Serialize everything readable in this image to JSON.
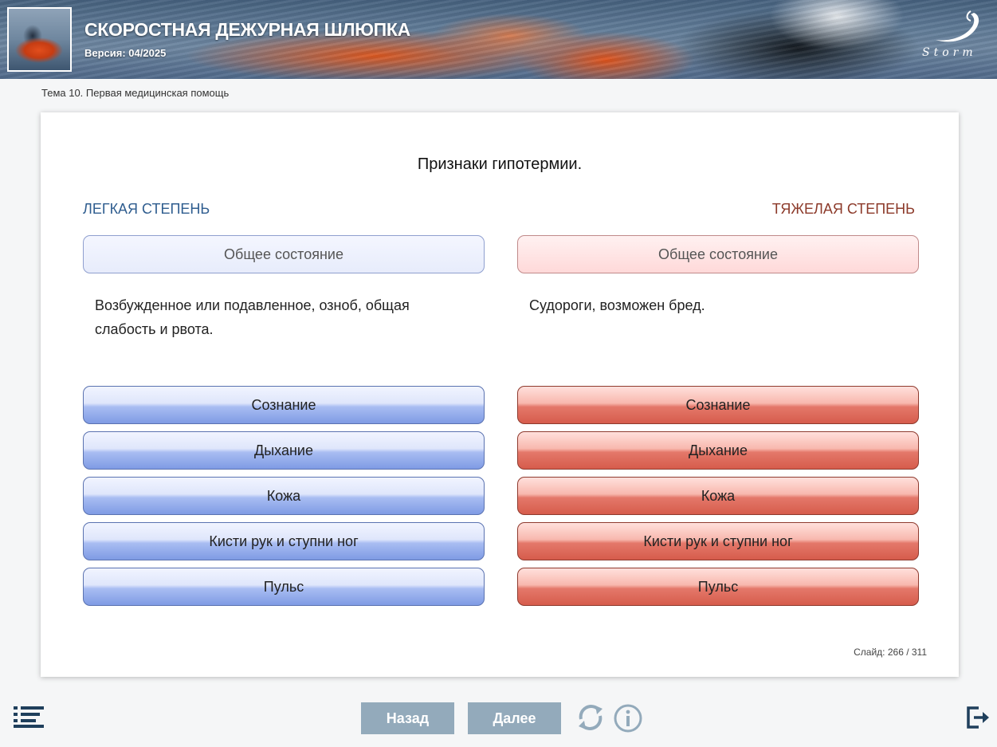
{
  "header": {
    "title": "СКОРОСТНАЯ ДЕЖУРНАЯ ШЛЮПКА",
    "version": "Версия: 04/2025",
    "logo_text": "Storm"
  },
  "topic": "Тема 10. Первая медицинская помощь",
  "slide_content": {
    "heading": "Признаки гипотермии.",
    "left": {
      "title": "ЛЕГКАЯ СТЕПЕНЬ",
      "state_label": "Общее состояние",
      "description": "Возбужденное или подавленное, озноб, общая слабость и рвота.",
      "buttons": [
        "Сознание",
        "Дыхание",
        "Кожа",
        "Кисти рук и ступни ног",
        "Пульс"
      ]
    },
    "right": {
      "title": "ТЯЖЕЛАЯ СТЕПЕНЬ",
      "state_label": "Общее состояние",
      "description": "Судороги, возможен бред.",
      "buttons": [
        "Сознание",
        "Дыхание",
        "Кожа",
        "Кисти рук и ступни ног",
        "Пульс"
      ]
    },
    "slide_counter": "Слайд:  266 / 311"
  },
  "navigation": {
    "back_label": "Назад",
    "next_label": "Далее",
    "icons": [
      "menu-list-icon",
      "reload-icon",
      "info-icon",
      "exit-icon"
    ]
  },
  "colors": {
    "left_accent": "#2f5d8f",
    "right_accent": "#8c3a2a",
    "nav_button": "#93aabb"
  }
}
